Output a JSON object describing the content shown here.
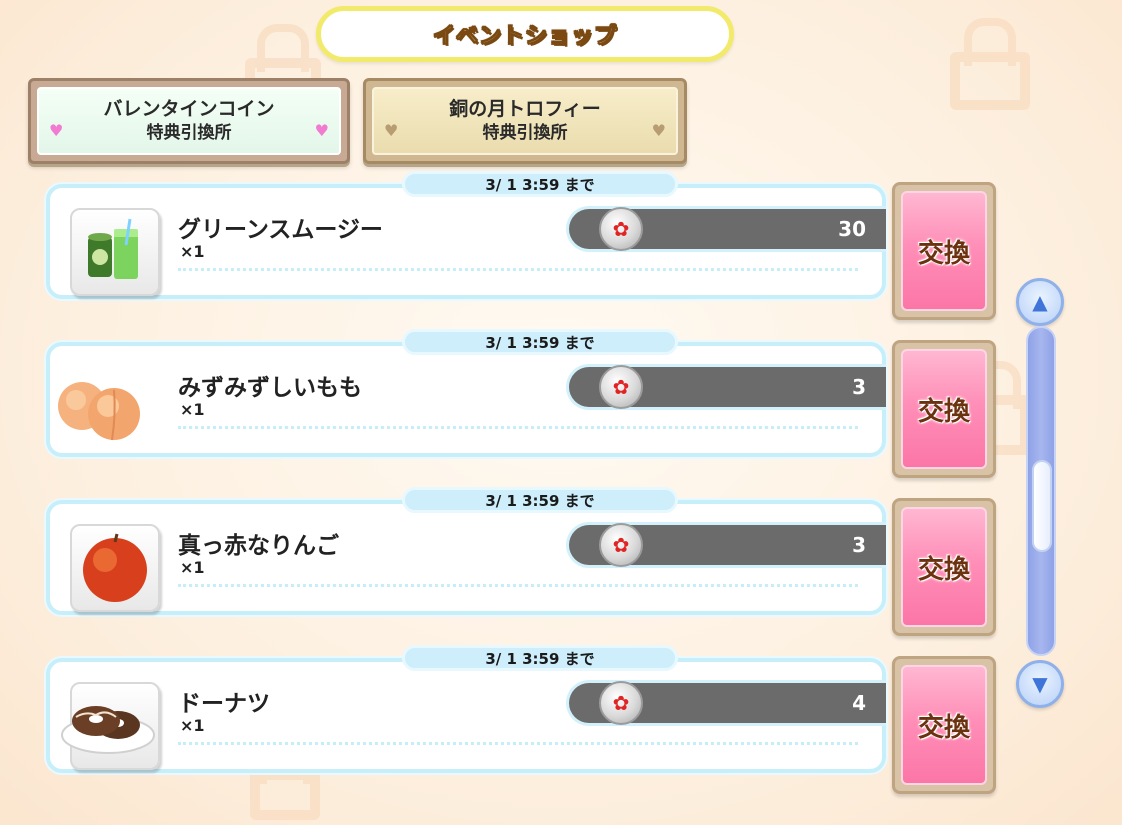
{
  "header": {
    "title": "イベントショップ"
  },
  "tabs": [
    {
      "line1": "バレンタインコイン",
      "line2": "特典引換所",
      "active": true
    },
    {
      "line1": "銅の月トロフィー",
      "line2": "特典引換所",
      "active": false
    }
  ],
  "items": [
    {
      "deadline": "3/ 1 3:59 まで",
      "name": "グリーンスムージー",
      "quantity": "×1",
      "cost": "30",
      "exchange_label": "交換",
      "icon": "green-smoothie-icon"
    },
    {
      "deadline": "3/ 1 3:59 まで",
      "name": "みずみずしいもも",
      "quantity": "×1",
      "cost": "3",
      "exchange_label": "交換",
      "icon": "peach-icon"
    },
    {
      "deadline": "3/ 1 3:59 まで",
      "name": "真っ赤なりんご",
      "quantity": "×1",
      "cost": "3",
      "exchange_label": "交換",
      "icon": "apple-icon"
    },
    {
      "deadline": "3/ 1 3:59 まで",
      "name": "ドーナツ",
      "quantity": "×1",
      "cost": "4",
      "exchange_label": "交換",
      "icon": "donut-icon"
    }
  ],
  "currency_icon": "valentine-coin-icon",
  "colors": {
    "header_border": "#f2ea6b",
    "exchange_button": "#ff8fb8",
    "cost_bar": "#6b6b6b",
    "card_border": "#c7effa",
    "scrollbar": "#8ea2e6"
  },
  "scroll": {
    "position_fraction": 0.5
  }
}
